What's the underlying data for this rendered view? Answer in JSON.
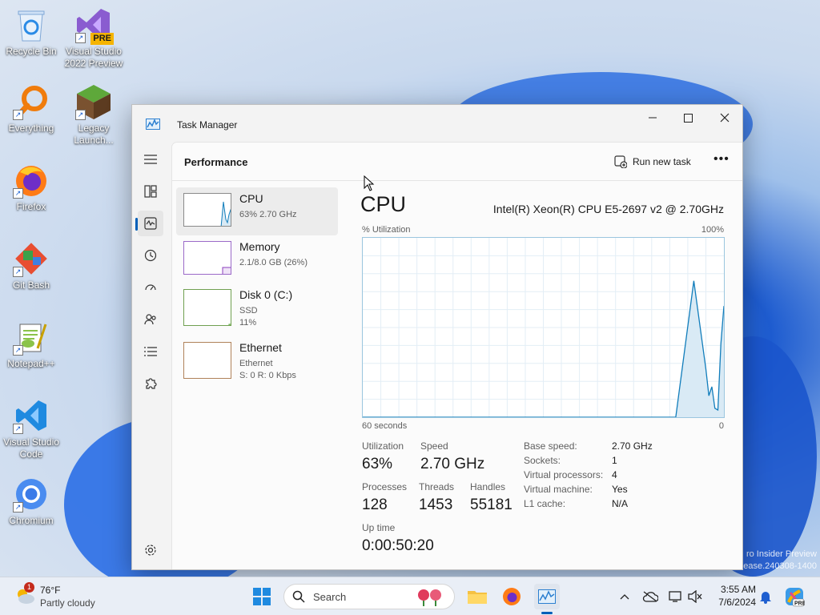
{
  "desktop": {
    "icons": [
      {
        "label": "Recycle Bin",
        "icon": "recycle-bin-icon"
      },
      {
        "label": "Visual Studio 2022 Preview",
        "icon": "visual-studio-icon",
        "badge": "PRE"
      },
      {
        "label": "Everything",
        "icon": "everything-search-icon"
      },
      {
        "label": "Legacy Launch...",
        "icon": "minecraft-launcher-icon"
      },
      {
        "label": "Firefox",
        "icon": "firefox-icon"
      },
      {
        "label": "Git Bash",
        "icon": "git-bash-icon"
      },
      {
        "label": "Notepad++",
        "icon": "notepad-plus-plus-icon"
      },
      {
        "label": "Visual Studio Code",
        "icon": "vscode-icon"
      },
      {
        "label": "Chromium",
        "icon": "chromium-icon"
      }
    ],
    "watermark_line1": "ro Insider Preview",
    "watermark_line2": "ease.240308-1400"
  },
  "window": {
    "title": "Task Manager",
    "page_title": "Performance",
    "run_new_task": "Run new task",
    "more": "•••"
  },
  "devices": [
    {
      "name": "CPU",
      "sub1": "63% 2.70 GHz",
      "sub2": ""
    },
    {
      "name": "Memory",
      "sub1": "2.1/8.0 GB (26%)",
      "sub2": ""
    },
    {
      "name": "Disk 0 (C:)",
      "sub1": "SSD",
      "sub2": "11%"
    },
    {
      "name": "Ethernet",
      "sub1": "Ethernet",
      "sub2": "S: 0 R: 0 Kbps"
    }
  ],
  "cpu": {
    "title": "CPU",
    "model": "Intel(R) Xeon(R) CPU E5-2697 v2 @ 2.70GHz",
    "util_label": "% Utilization",
    "util_max": "100%",
    "time_label": "60 seconds",
    "time_end": "0",
    "utilization_label": "Utilization",
    "utilization": "63%",
    "speed_label": "Speed",
    "speed": "2.70 GHz",
    "processes_label": "Processes",
    "processes": "128",
    "threads_label": "Threads",
    "threads": "1453",
    "handles_label": "Handles",
    "handles": "55181",
    "uptime_label": "Up time",
    "uptime": "0:00:50:20",
    "details": [
      {
        "k": "Base speed:",
        "v": "2.70 GHz"
      },
      {
        "k": "Sockets:",
        "v": "1"
      },
      {
        "k": "Virtual processors:",
        "v": "4"
      },
      {
        "k": "Virtual machine:",
        "v": "Yes"
      },
      {
        "k": "L1 cache:",
        "v": "N/A"
      }
    ]
  },
  "chart_data": {
    "type": "area",
    "x": [
      60,
      8,
      5,
      3,
      2.5,
      2,
      1.5,
      1,
      0.5,
      0
    ],
    "values": [
      0,
      0,
      76,
      27,
      12,
      17,
      5,
      4,
      41,
      62
    ],
    "ylim": [
      0,
      100
    ],
    "xlim": [
      60,
      0
    ],
    "grid": true,
    "color": "#117dbb"
  },
  "taskbar": {
    "weather_temp": "76°F",
    "weather_desc": "Partly cloudy",
    "weather_badge": "1",
    "search_placeholder": "Search",
    "time": "3:55 AM",
    "date": "7/6/2024"
  },
  "colors": {
    "accent": "#005fb8",
    "graph_line": "#117dbb",
    "graph_fill": "#d9eaf5"
  }
}
